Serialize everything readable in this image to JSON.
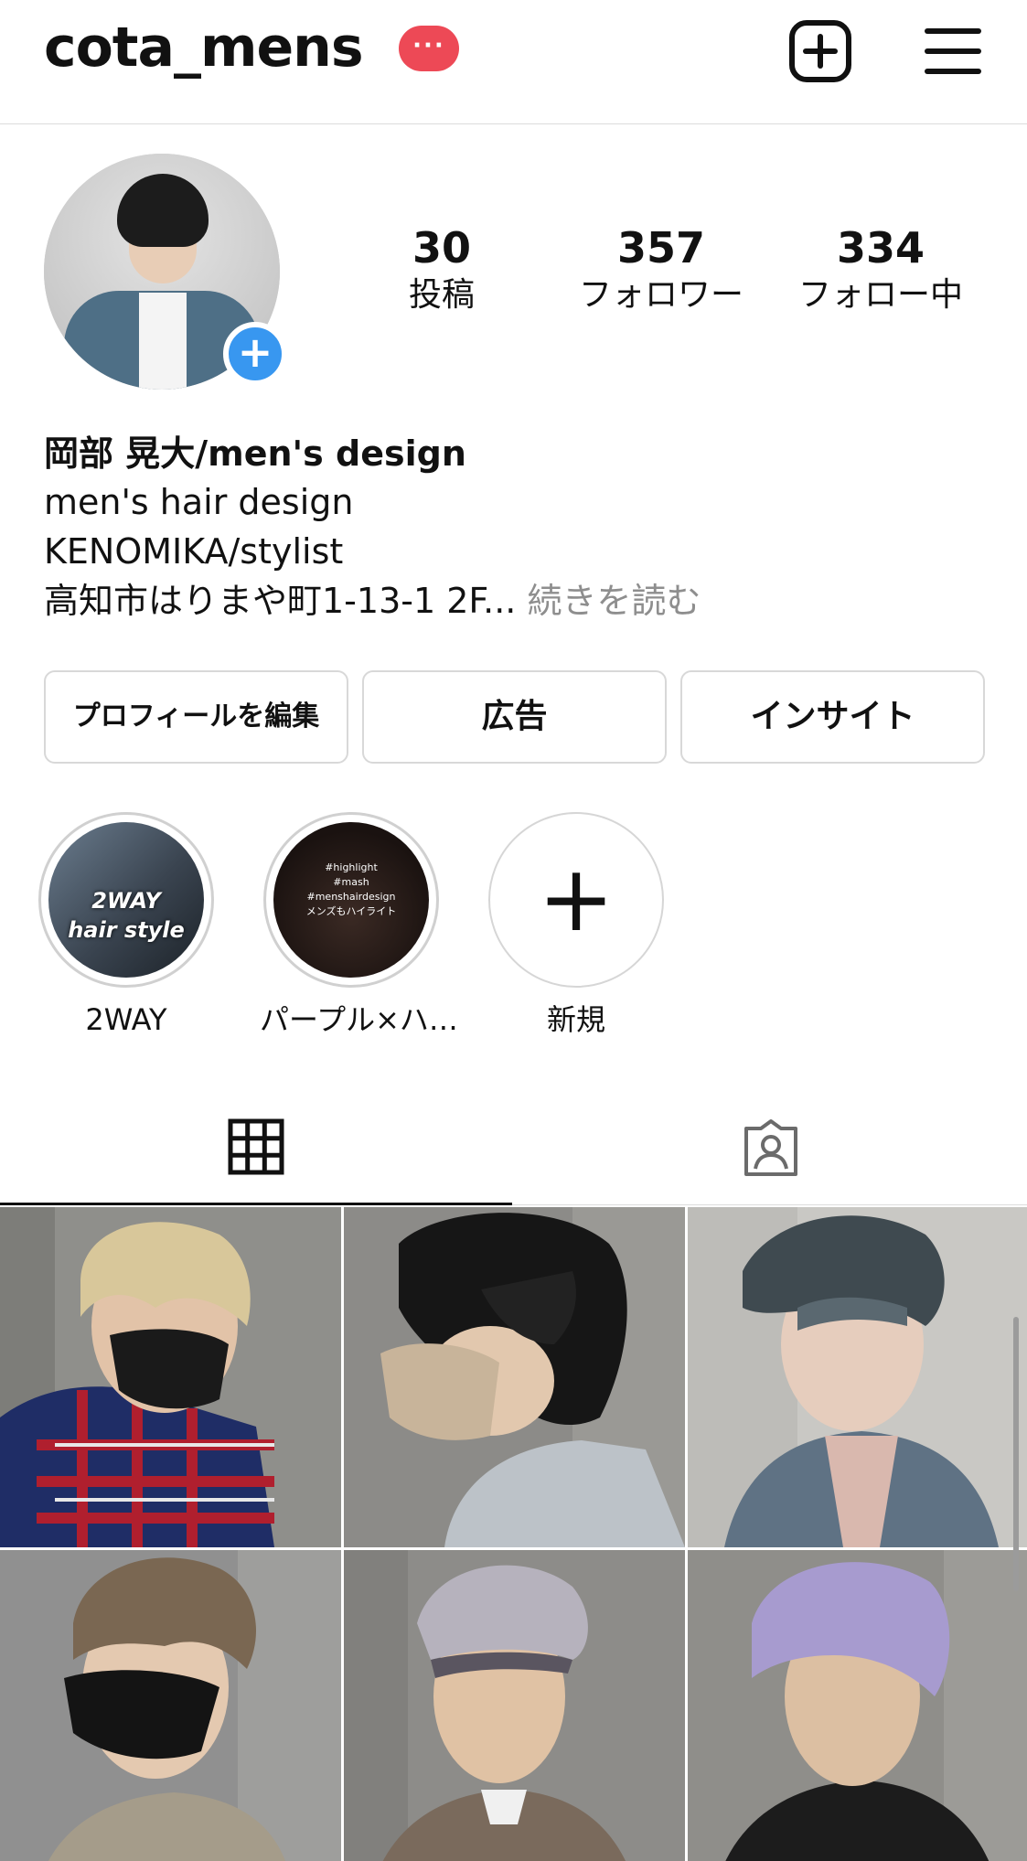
{
  "header": {
    "username": "cota_mens",
    "badge": "···"
  },
  "profile": {
    "add_story": "+"
  },
  "stats": [
    {
      "value": "30",
      "label": "投稿"
    },
    {
      "value": "357",
      "label": "フォロワー"
    },
    {
      "value": "334",
      "label": "フォロー中"
    }
  ],
  "bio": {
    "name": "岡部 晃大/men's design",
    "line1": "men's hair design",
    "line2": "KENOMIKA/stylist",
    "line3": "高知市はりまや町1-13-1 2F...",
    "more": " 続きを読む"
  },
  "buttons": {
    "edit": "プロフィールを編集",
    "ads": "広告",
    "insights": "インサイト"
  },
  "highlights": [
    {
      "caption": "2WAY",
      "overlay_line1": "2WAY",
      "overlay_line2": "hair style"
    },
    {
      "caption": "パープル×ハ…",
      "overlay_line1": "#highlight",
      "overlay_line2": "#mash",
      "overlay_line3": "#menshairdesign",
      "overlay_line4": "メンズもハイライト"
    },
    {
      "caption": "新規",
      "icon": "+"
    }
  ],
  "colors": {
    "badge": "#ed4956",
    "add_story": "#3897f0",
    "border": "#dcdcdc",
    "muted_text": "#8e8e8e"
  },
  "icons": {
    "new_post": "plus-square-icon",
    "menu": "hamburger-menu-icon",
    "grid_tab": "grid-icon",
    "tagged_tab": "tagged-person-icon"
  }
}
